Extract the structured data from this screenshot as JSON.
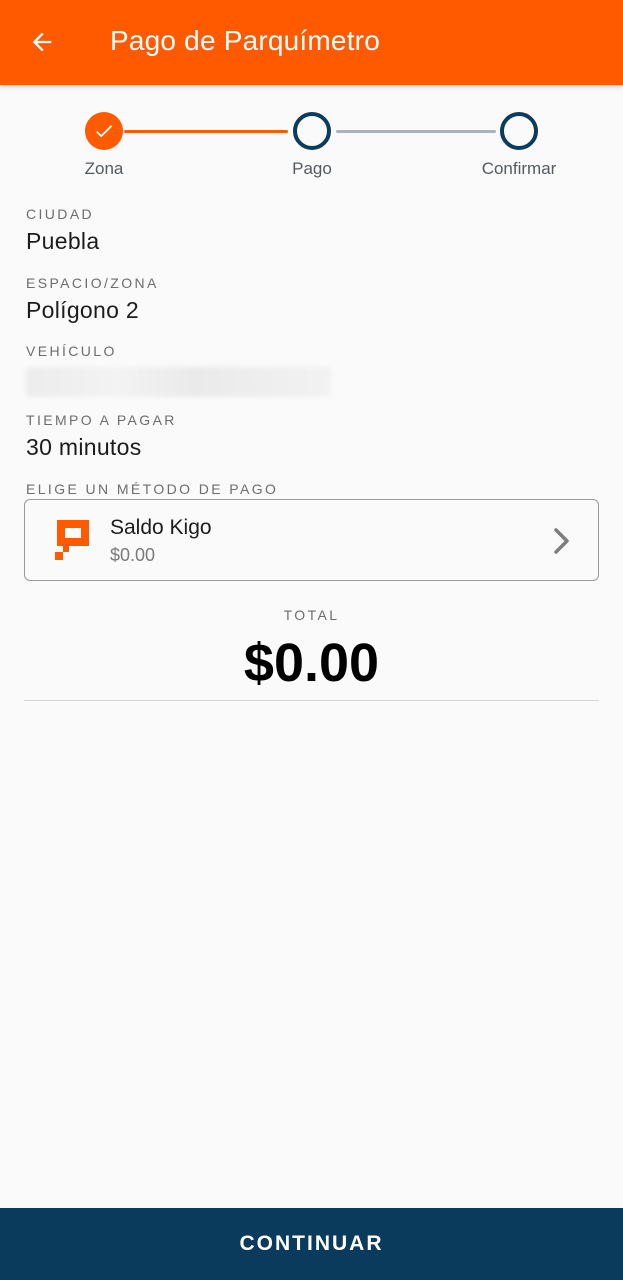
{
  "appbar": {
    "title": "Pago de Parquímetro",
    "back_icon": "arrow-left-icon",
    "color": "#ff5a00"
  },
  "stepper": {
    "steps": [
      {
        "label": "Zona",
        "state": "done"
      },
      {
        "label": "Pago",
        "state": "pending"
      },
      {
        "label": "Confirmar",
        "state": "pending"
      }
    ],
    "active_color": "#ff5a00",
    "pending_color": "#0b3c5d"
  },
  "fields": {
    "city": {
      "label": "CIUDAD",
      "value": "Puebla"
    },
    "zone": {
      "label": "ESPACIO/ZONA",
      "value": "Polígono 2"
    },
    "vehicle": {
      "label": "VEHÍCULO"
    },
    "time": {
      "label": "TIEMPO A PAGAR",
      "value": "30 minutos"
    }
  },
  "payment": {
    "section_label": "ELIGE UN MÉTODO DE PAGO",
    "method_name": "Saldo Kigo",
    "method_balance": "$0.00",
    "logo_icon": "kigo-logo-icon",
    "chevron_icon": "chevron-right-icon"
  },
  "total": {
    "label": "TOTAL",
    "value": "$0.00"
  },
  "footer": {
    "continue_label": "CONTINUAR",
    "color": "#0a3b5c"
  }
}
